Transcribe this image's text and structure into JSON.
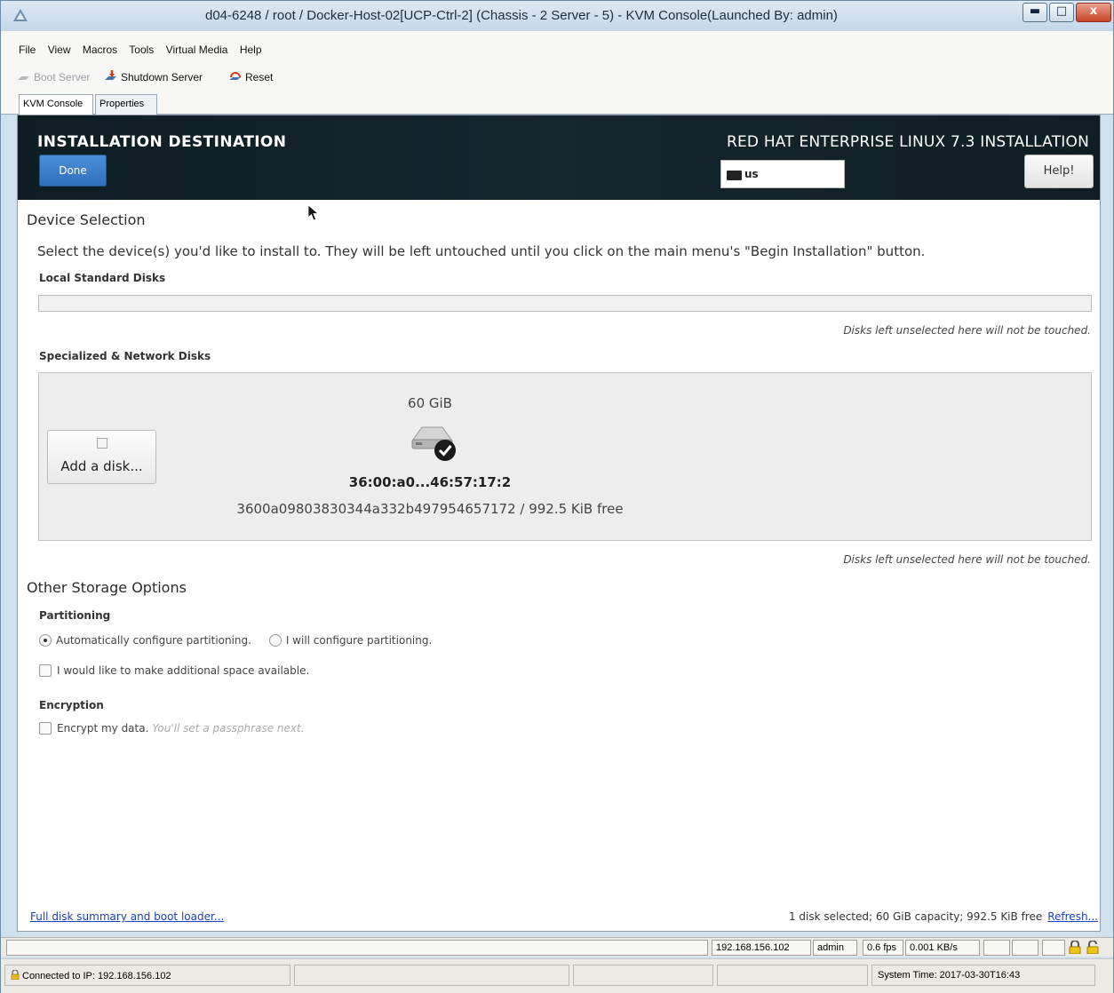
{
  "window": {
    "title": "d04-6248 / root / Docker-Host-02[UCP-Ctrl-2] (Chassis - 2 Server - 5) - KVM Console(Launched By: admin)"
  },
  "menu": [
    "File",
    "View",
    "Macros",
    "Tools",
    "Virtual Media",
    "Help"
  ],
  "toolbar": {
    "boot": "Boot Server",
    "shutdown": "Shutdown Server",
    "reset": "Reset"
  },
  "tabs": [
    "KVM Console",
    "Properties"
  ],
  "installer": {
    "header_title": "INSTALLATION DESTINATION",
    "done": "Done",
    "product": "RED HAT ENTERPRISE LINUX 7.3 INSTALLATION",
    "keyboard": "us",
    "help": "Help!",
    "device_selection": "Device Selection",
    "description": "Select the device(s) you'd like to install to.  They will be left untouched until you click on the main menu's \"Begin Installation\" button.",
    "local_disks": "Local Standard Disks",
    "note": "Disks left unselected here will not be touched.",
    "network_disks": "Specialized & Network Disks",
    "add_disk": "Add a disk...",
    "disk": {
      "size": "60 GiB",
      "name": "36:00:a0...46:57:17:2",
      "detail": "3600a09803830344a332b497954657172 / 992.5 KiB free"
    },
    "other_storage": "Other Storage Options",
    "partitioning": "Partitioning",
    "auto_partition": "Automatically configure partitioning.",
    "manual_partition": "I will configure partitioning.",
    "additional_space": "I would like to make additional space available.",
    "encryption": "Encryption",
    "encrypt": "Encrypt my data.",
    "encrypt_hint": "You'll set a passphrase next.",
    "summary_link": "Full disk summary and boot loader...",
    "summary": "1 disk selected; 60 GiB capacity; 992.5 KiB free",
    "refresh": "Refresh..."
  },
  "kvm_status": {
    "ip": "192.168.156.102",
    "user": "admin",
    "fps": "0.6 fps",
    "rate": "0.001 KB/s"
  },
  "status_bar": {
    "connected": "Connected to IP: 192.168.156.102",
    "system_time": "System Time: 2017-03-30T16:43"
  },
  "colors": {
    "header_bg": "#14272d",
    "done_button": "#3a7fcb",
    "link": "#1a3fc4"
  }
}
